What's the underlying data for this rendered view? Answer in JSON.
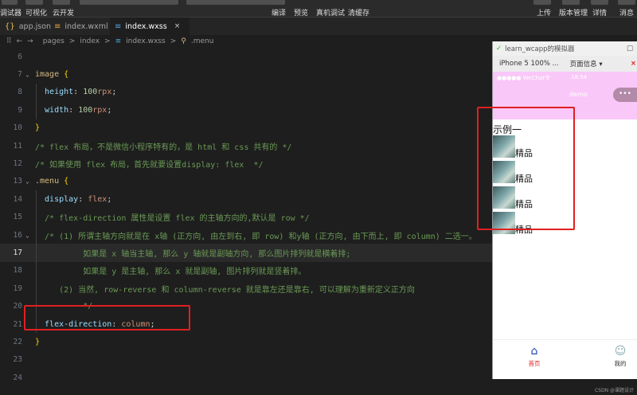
{
  "toolbar": {
    "left_items": [
      "调试器",
      "可视化",
      "云开发"
    ],
    "right_mid_items": [
      "编译",
      "预览",
      "真机调试",
      "清缓存"
    ],
    "right_items": [
      "上传",
      "版本管理",
      "详情",
      "消息"
    ]
  },
  "tabs": [
    {
      "icon": "{}",
      "label": "app.json"
    },
    {
      "icon": "≡",
      "label": "index.wxml"
    },
    {
      "icon": "≡",
      "label": "index.wxss",
      "close": "×"
    }
  ],
  "breadcrumb": {
    "back": "←",
    "forward": "→",
    "path": [
      "pages",
      ">",
      "index",
      ">",
      "index.wxss",
      ">",
      ".menu"
    ]
  },
  "editor": {
    "current_line": "17",
    "lines": [
      {
        "n": "6",
        "parts": []
      },
      {
        "n": "7",
        "fold": "⌄",
        "parts": [
          {
            "c": "sel",
            "t": "image "
          },
          {
            "c": "brace",
            "t": "{"
          }
        ]
      },
      {
        "n": "8",
        "parts": [
          {
            "c": "prop",
            "t": "  height"
          },
          {
            "c": "plain",
            "t": ": "
          },
          {
            "c": "num",
            "t": "100"
          },
          {
            "c": "unit",
            "t": "rpx"
          },
          {
            "c": "plain",
            "t": ";"
          }
        ]
      },
      {
        "n": "9",
        "parts": [
          {
            "c": "prop",
            "t": "  width"
          },
          {
            "c": "plain",
            "t": ": "
          },
          {
            "c": "num",
            "t": "100"
          },
          {
            "c": "unit",
            "t": "rpx"
          },
          {
            "c": "plain",
            "t": ";"
          }
        ]
      },
      {
        "n": "10",
        "parts": [
          {
            "c": "brace",
            "t": "}"
          }
        ]
      },
      {
        "n": "11",
        "parts": [
          {
            "c": "cm",
            "t": "/* flex 布局，不是微信小程序特有的，是 html 和 css 共有的 */"
          }
        ]
      },
      {
        "n": "12",
        "parts": [
          {
            "c": "cm",
            "t": "/* 如果使用 flex 布局，首先就要设置display: flex  */"
          }
        ]
      },
      {
        "n": "13",
        "fold": "⌄",
        "parts": [
          {
            "c": "sel",
            "t": ".menu "
          },
          {
            "c": "brace",
            "t": "{"
          }
        ]
      },
      {
        "n": "14",
        "parts": [
          {
            "c": "prop",
            "t": "  display"
          },
          {
            "c": "plain",
            "t": ": "
          },
          {
            "c": "val",
            "t": "flex"
          },
          {
            "c": "plain",
            "t": ";"
          }
        ]
      },
      {
        "n": "15",
        "parts": [
          {
            "c": "cm",
            "t": "  /* flex-direction 属性是设置 flex 的主轴方向的,默认是 row */"
          }
        ]
      },
      {
        "n": "16",
        "fold": "⌄",
        "parts": [
          {
            "c": "cm",
            "t": "  /* (1) 所谓主轴方向就是在 x轴 (正方向, 由左到右, 即 row) 和y轴 (正方向, 由下而上, 即 column) 二选一。"
          }
        ]
      },
      {
        "n": "17",
        "parts": [
          {
            "c": "cm",
            "t": "          如果是 x 轴当主轴, 那么 y 轴就是副轴方向, 那么图片排列就是横着排;"
          }
        ]
      },
      {
        "n": "18",
        "parts": [
          {
            "c": "cm",
            "t": "          如果是 y 是主轴, 那么 x 就是副轴, 图片排列就是竖着排。"
          }
        ]
      },
      {
        "n": "19",
        "parts": [
          {
            "c": "cm",
            "t": "     (2) 当然, row-reverse 和 column-reverse 就是靠左还是靠右, 可以理解为重新定义正方向"
          }
        ]
      },
      {
        "n": "20",
        "parts": [
          {
            "c": "cm",
            "t": "          */"
          }
        ]
      },
      {
        "n": "21",
        "parts": [
          {
            "c": "prop",
            "t": "  flex-direction"
          },
          {
            "c": "plain",
            "t": ": "
          },
          {
            "c": "val",
            "t": "column"
          },
          {
            "c": "plain",
            "t": ";"
          }
        ]
      },
      {
        "n": "22",
        "parts": [
          {
            "c": "brace",
            "t": "}"
          }
        ]
      },
      {
        "n": "23",
        "parts": []
      },
      {
        "n": "24",
        "parts": []
      }
    ]
  },
  "simulator": {
    "title": "learn_wcapp的模拟器",
    "device": "iPhone 5 100% ...",
    "page_info": "页面信息 ▾",
    "status_left": "●●●●● WeChat令",
    "status_time": "18:54",
    "nav_title": "demo",
    "capsule_dots": "•••",
    "heading": "示例一",
    "items": [
      "精品",
      "精品",
      "精品",
      "精品"
    ],
    "tabbar": [
      {
        "icon": "⌂",
        "label": "首页",
        "color": "#e02020"
      },
      {
        "icon": "☺",
        "label": "我的",
        "color": "#333333"
      }
    ]
  },
  "watermark": "CSDN @课题设计"
}
